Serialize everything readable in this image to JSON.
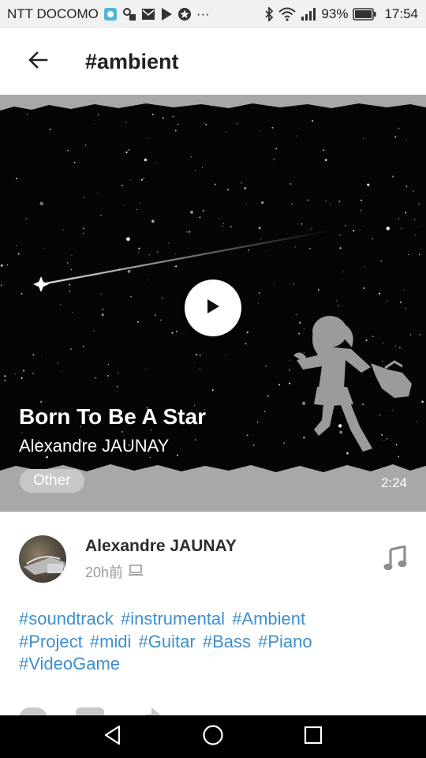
{
  "status_bar": {
    "carrier": "NTT DOCOMO",
    "battery": "93%",
    "time": "17:54",
    "more_indicator": "···",
    "icons": [
      "app-icon",
      "settings-icon",
      "mail-icon",
      "play-store-icon",
      "star-icon",
      "bluetooth-icon",
      "wifi-icon",
      "signal-icon",
      "battery-icon"
    ]
  },
  "app_bar": {
    "title": "#ambient",
    "back_icon": "arrow-left-icon"
  },
  "track": {
    "title": "Born To Be A Star",
    "artist": "Alexandre JAUNAY",
    "genre": "Other",
    "duration": "2:24",
    "play_icon": "play-icon"
  },
  "post": {
    "author": "Alexandre JAUNAY",
    "time_ago": "20h前",
    "device_icon": "laptop-icon",
    "type_icon": "music-note-icon",
    "tags": [
      "#soundtrack",
      "#instrumental",
      "#Ambient",
      "#Project",
      "#midi",
      "#Guitar",
      "#Bass",
      "#Piano",
      "#VideoGame"
    ]
  },
  "actions": {
    "icons": [
      "heart-icon",
      "comment-icon",
      "share-icon"
    ]
  },
  "nav_bar": {
    "icons": [
      "back-triangle-icon",
      "home-circle-icon",
      "recents-square-icon"
    ]
  },
  "colors": {
    "tag_blue": "#3d8fce",
    "hero_gray": "#a8a8a8",
    "statusbar_bg": "#f1f1f1",
    "navbar_bg": "#000000"
  }
}
